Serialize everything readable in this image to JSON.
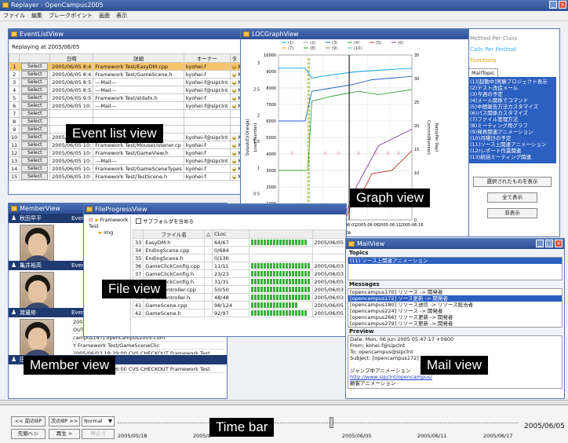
{
  "app": {
    "title": "Replayer - OpenCampus2005",
    "menu": [
      "ファイル",
      "編集",
      "ブレークポイント",
      "画面",
      "表示"
    ]
  },
  "event_list": {
    "title": "EventListView",
    "replaying": "Replaying at 2005/06/05",
    "columns": [
      "",
      "",
      "日時",
      "詳細",
      "オーナー",
      "タ"
    ],
    "select_label": "Select",
    "rows": [
      [
        "1",
        "2005/06/05 8:4",
        "Framework Test/EasyDM.cpp",
        "kyohei-f",
        "MO"
      ],
      [
        "2",
        "2005/06/05 8:4",
        "Framework Test/GameScene.h",
        "kyohei-f",
        "MO"
      ],
      [
        "3",
        "2005/06/05 8:5",
        "---Mail---",
        "kyohei-f@sipclnt",
        "MA"
      ],
      [
        "4",
        "2005/06/05 8:5",
        "---Mail---",
        "kyohei-f@sipclnt",
        "MA"
      ],
      [
        "5",
        "2005/06/05 9:5",
        "Framework Test/stdafx.h",
        "kyohei-f",
        "MO"
      ],
      [
        "6",
        "2005/06/05 10:",
        "---Mail---",
        "kyohei-f@sipclnt",
        "MA"
      ],
      [
        "7",
        "",
        "",
        "",
        ""
      ],
      [
        "8",
        "",
        "",
        "",
        ""
      ],
      [
        "9",
        "",
        "",
        "",
        ""
      ],
      [
        "10",
        "2005/06/05 10:",
        "---Mail---",
        "kyohei-f@sipclnt",
        "MA"
      ],
      [
        "11",
        "2005/06/05 10:",
        "Framework Test/MouseListener.cp",
        "kyohei-f",
        "MO"
      ],
      [
        "12",
        "2005/06/05 10:",
        "Framework Test/GameView.h",
        "kyohei-f",
        "MO"
      ],
      [
        "13",
        "2005/06/05 10:",
        "---Mail---",
        "kyohei-f@sipclnt",
        "MA"
      ],
      [
        "14",
        "2005/06/05 10:",
        "Framework Test/GameSceneTypes",
        "kyohei-f",
        "MO"
      ],
      [
        "15",
        "2005/06/05 10:",
        "Framework Test/TestScene.h",
        "kyohei-f",
        "MO"
      ]
    ]
  },
  "graph": {
    "title": "LOCGraphView",
    "xlabel": "Date",
    "ylabel_left": "Lines(Number)",
    "ylabel_left2": "Output(E)(Oranga)",
    "ylabel_right": "Commit(Number)",
    "ylabel_right2": "Ratio(Per Day)",
    "x_ticks": [
      "2005-05-17",
      "2005-05-22",
      "2005-05-27",
      "2005-06-01",
      "2005-06-06",
      "2005-06-11",
      "2005-06-16"
    ],
    "y_ticks_left": [
      "10000",
      "9000",
      "8000",
      "7000",
      "6000",
      "5000",
      "4000",
      "3000",
      "2000",
      "1000",
      "0"
    ],
    "y_ticks_left2": [
      "3",
      "2.5",
      "2",
      "1.5",
      "1",
      "0.5",
      "0"
    ],
    "y_ticks_right": [
      "35",
      "30",
      "25",
      "20",
      "15",
      "10",
      "5",
      "0"
    ],
    "legend": [
      "(1)",
      "(2)",
      "(3)",
      "(4)",
      "(5)",
      "(6)",
      "(7)",
      "(8)",
      "(9)",
      "(10)"
    ]
  },
  "right_panel": {
    "checks": [
      "Method Per Class",
      "Calls Per Method",
      "Functions"
    ],
    "tab": "MailTopic",
    "topics": [
      "(1)[起動中]実験プロジェクト表示",
      "(2)テスト改造メール",
      "(3)今週の予定",
      "(4)メール関係でコマンド",
      "(5)中間報告方法カスタマイズ",
      "(6)パス関係カスタマイズ",
      "(7)ファイル管理方法",
      "(8)ミーティング用グラフ",
      "(9)発表関連アニメーション",
      "(10)月曜日の予定",
      "(11)ソース上関連アニメーション",
      "(12)レポート作業関連",
      "(13)統括ミーティング関連"
    ],
    "buttons": [
      "選択されたものを表示",
      "全て表示",
      "非表示"
    ]
  },
  "member": {
    "title": "MemberView",
    "members": [
      "秋田早平",
      "亀井裕高",
      "渡邊修",
      "田中奈弘"
    ],
    "history_label": "Event History",
    "history": [
      "2005/06/03 19:38:00 CVS CHECKOUT Framework Test",
      "OUT Framework Test",
      "campus147] opencampus2005-com",
      "Y Framework Test/GameSceneClic",
      "2005/06/03 19:29:00 CVS CHECKOUT Framework Test",
      "2005/06/03 17:46:00 CVS CHECKOUT Framework Test"
    ]
  },
  "file_progress": {
    "title": "FileProgressView",
    "tree_root": "Framework Test",
    "tree_child": "img",
    "checkbox": "サブフォルダを含める",
    "columns": [
      "",
      "ファイル名",
      "△",
      "CLoc"
    ],
    "rows": [
      [
        "33",
        "EasyDM.h",
        "64/67",
        "2005/06/05"
      ],
      [
        "34",
        "EndingScene.cpp",
        "0/684",
        ""
      ],
      [
        "35",
        "EndingScene.h",
        "0/136",
        ""
      ],
      [
        "36",
        "GameClickConfig.cpp",
        "11/11",
        "2005/06/03"
      ],
      [
        "37",
        "GameClickConfig.h",
        "23/23",
        "2005/06/03"
      ],
      [
        "38",
        "GameClickConfig.h",
        "31/31",
        "2005/06/05"
      ],
      [
        "39",
        "GameController.cpp",
        "50/50",
        "2005/06/03"
      ],
      [
        "40",
        "GameController.h",
        "48/48",
        "2005/06/03"
      ],
      [
        "41",
        "GameScene.cpp",
        "98/124",
        "2005/06/05"
      ],
      [
        "42",
        "GameScene.h",
        "92/97",
        "2005/06/05"
      ]
    ],
    "progress": [
      0.95,
      0,
      0,
      1,
      1,
      1,
      1,
      1,
      0.79,
      0.95
    ]
  },
  "mail": {
    "title": "MailView",
    "topics_label": "Topics",
    "topic_selected": "(11) ソース上関連アニメーション",
    "messages_label": "Messages",
    "messages": [
      "[opencampus170] リソース -> 関発者",
      "[opencampus172] ソース更新 -> 関発者",
      "[opencampus180] リソース送信 -> リソース担当者",
      "[opencampus224] リソース -> 関発者",
      "[opencampus266] リソース更新 -> 関発者",
      "[opencampus279] リソース更新 -> 関発者"
    ],
    "preview_label": "Preview",
    "preview": [
      "Date: Mon, 06 Jun 2005 05:47:17 +0900",
      "From: kohei-f@sipclnt",
      "To: opencampus@sipclnt",
      "Subject: [opencampus172]",
      "",
      "ジャンプ中アニメーション",
      "http://www.sipclnt/opencampus/",
      "顧客アニメーション"
    ]
  },
  "timebar": {
    "prev_bp": "<< 前のBP",
    "next_bp": "次のBP >>",
    "speed": "Normal",
    "to_start": "先頭へ ▷",
    "play": "再生 >",
    "stop": "停止 ||",
    "dates": [
      "2005/05/18",
      "2005/0",
      "2005/06/05",
      "2005/06/11",
      "2005/06/17"
    ],
    "current": "2005/06/05",
    "position": 0.53
  },
  "labels": {
    "event": "Event list view",
    "graph": "Graph view",
    "file": "File view",
    "member": "Member view",
    "mail": "Mail view",
    "time": "Time bar"
  }
}
